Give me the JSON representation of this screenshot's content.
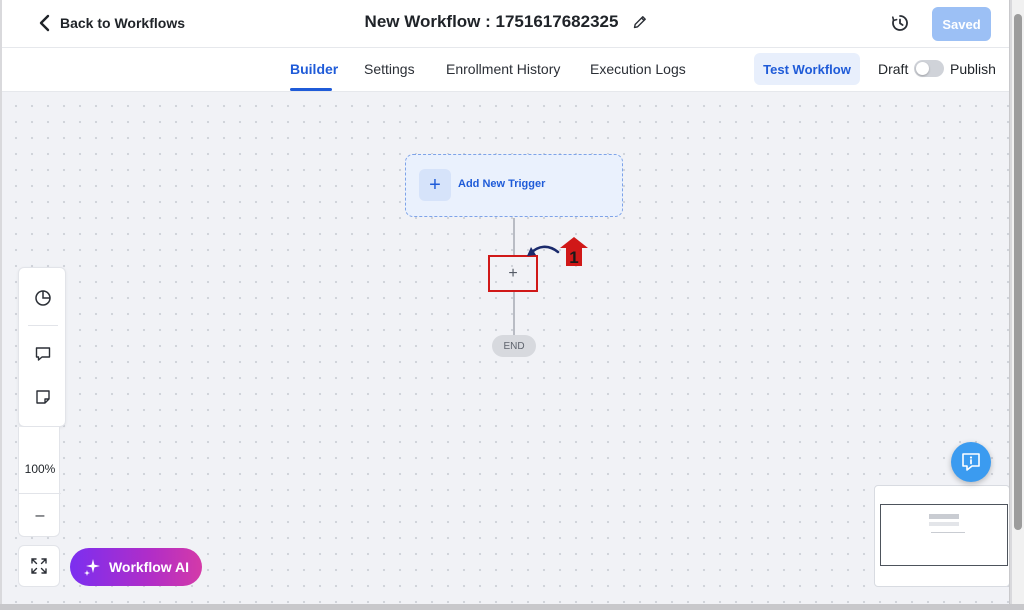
{
  "header": {
    "back_label": "Back to Workflows",
    "title": "New Workflow : 1751617682325",
    "saved_label": "Saved"
  },
  "tabs": [
    {
      "label": "Builder",
      "active": true
    },
    {
      "label": "Settings",
      "active": false
    },
    {
      "label": "Enrollment History",
      "active": false
    },
    {
      "label": "Execution Logs",
      "active": false
    }
  ],
  "actions": {
    "test_label": "Test Workflow",
    "draft_label": "Draft",
    "publish_label": "Publish",
    "publish_toggle_on": false
  },
  "canvas": {
    "trigger_label": "Add New Trigger",
    "end_label": "END",
    "annotation_number": "1"
  },
  "controls": {
    "zoom_value": "100%",
    "zoom_out_label": "–",
    "ai_label": "Workflow AI"
  },
  "colors": {
    "primary": "#1f5bd8",
    "saved_button": "#9cc0f5",
    "annotation_red": "#d01818",
    "chat_button": "#3b9bf0"
  },
  "icons": {
    "back": "chevron-left-icon",
    "edit": "pencil-icon",
    "history": "clock-history-icon",
    "tool1": "pie-chart-icon",
    "tool2": "comment-icon",
    "tool3": "sticky-note-icon",
    "fit": "fit-screen-icon",
    "ai": "sparkle-icon",
    "chat": "chat-info-icon"
  }
}
